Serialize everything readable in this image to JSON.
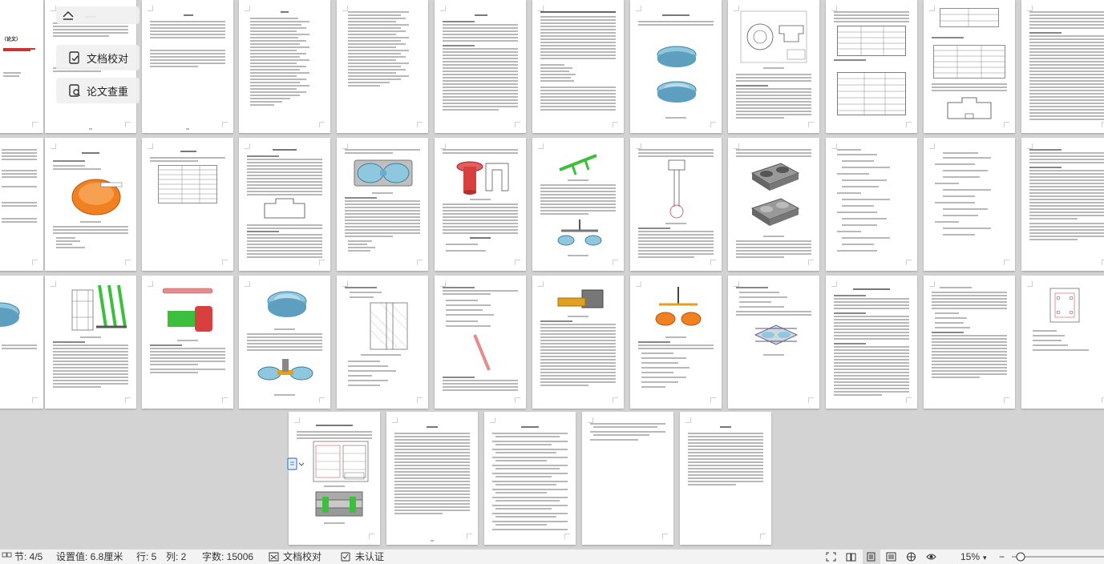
{
  "side_panel": {
    "doc_check_label": "文档校对",
    "plagiarism_label": "论文查重"
  },
  "first_page": {
    "title_fragment": "（论文）"
  },
  "statusbar": {
    "section": "节: 4/5",
    "setting": "设置值: 6.8厘米",
    "row": "行: 5",
    "col": "列: 2",
    "word_count": "字数: 15006",
    "doc_check": "文档校对",
    "cert": "未认证",
    "zoom": "15%"
  },
  "colors": {
    "canvas": "#d3d3d3",
    "page": "#ffffff",
    "orange_part": "#f08020",
    "blue_part": "#8fc7df",
    "green_part": "#3cbf3c",
    "red_part": "#d84040",
    "grey_part": "#777777"
  },
  "icons": [
    "home-outline-icon",
    "doc-check-icon",
    "plagiarism-icon",
    "doc-check-box-icon",
    "cert-shield-icon",
    "expand-icon",
    "read-mode-icon",
    "page-view-icon",
    "outline-view-icon",
    "web-view-icon",
    "eye-icon",
    "zoom-slider-icon"
  ]
}
